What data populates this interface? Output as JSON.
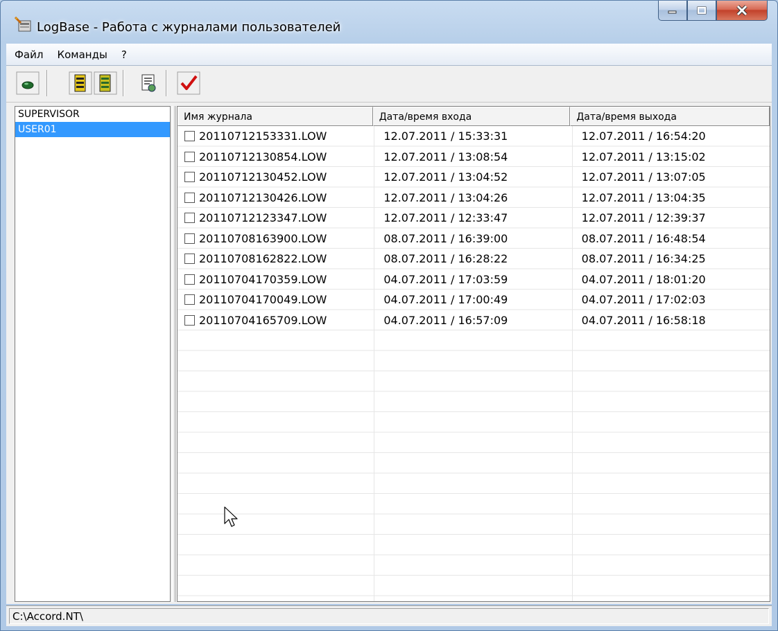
{
  "window": {
    "title": "LogBase - Работа с журналами пользователей"
  },
  "menu": {
    "items": [
      "Файл",
      "Команды",
      "?"
    ]
  },
  "toolbar": {
    "icons": [
      "open-folder-icon",
      "database-icon",
      "database-pair-icon",
      "document-properties-icon",
      "checkmark-icon"
    ]
  },
  "users": {
    "items": [
      {
        "label": "SUPERVISOR",
        "selected": false
      },
      {
        "label": "USER01",
        "selected": true
      }
    ]
  },
  "logs": {
    "columns": [
      "Имя журнала",
      "Дата/время входа",
      "Дата/время выхода"
    ],
    "rows": [
      {
        "name": "20110712153331.LOW",
        "login": "12.07.2011 / 15:33:31",
        "logout": "12.07.2011 / 16:54:20"
      },
      {
        "name": "20110712130854.LOW",
        "login": "12.07.2011 / 13:08:54",
        "logout": "12.07.2011 / 13:15:02"
      },
      {
        "name": "20110712130452.LOW",
        "login": "12.07.2011 / 13:04:52",
        "logout": "12.07.2011 / 13:07:05"
      },
      {
        "name": "20110712130426.LOW",
        "login": "12.07.2011 / 13:04:26",
        "logout": "12.07.2011 / 13:04:35"
      },
      {
        "name": "20110712123347.LOW",
        "login": "12.07.2011 / 12:33:47",
        "logout": "12.07.2011 / 12:39:37"
      },
      {
        "name": "20110708163900.LOW",
        "login": "08.07.2011 / 16:39:00",
        "logout": "08.07.2011 / 16:48:54"
      },
      {
        "name": "20110708162822.LOW",
        "login": "08.07.2011 / 16:28:22",
        "logout": "08.07.2011 / 16:34:25"
      },
      {
        "name": "20110704170359.LOW",
        "login": "04.07.2011 / 17:03:59",
        "logout": "04.07.2011 / 18:01:20"
      },
      {
        "name": "20110704170049.LOW",
        "login": "04.07.2011 / 17:00:49",
        "logout": "04.07.2011 / 17:02:03"
      },
      {
        "name": "20110704165709.LOW",
        "login": "04.07.2011 / 16:57:09",
        "logout": "04.07.2011 / 16:58:18"
      }
    ]
  },
  "status": {
    "path": "C:\\Accord.NT\\"
  },
  "colors": {
    "selection": "#3399ff",
    "checkmark": "#d01010",
    "close_button": "#c2412a"
  }
}
